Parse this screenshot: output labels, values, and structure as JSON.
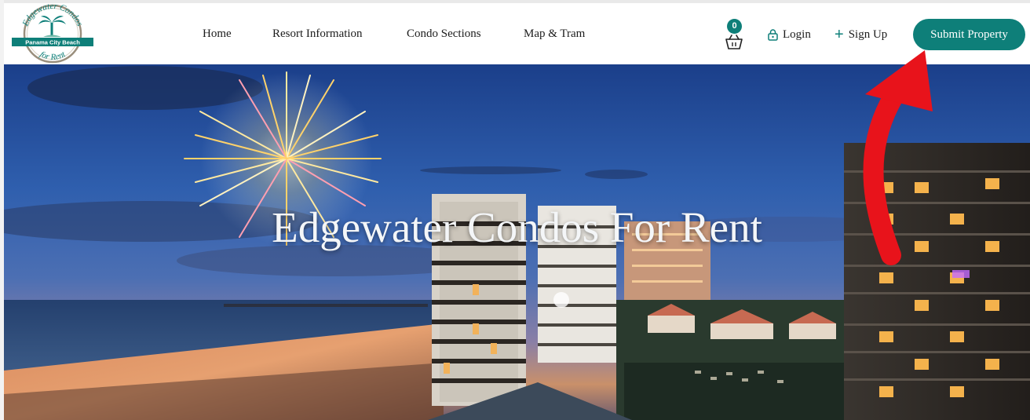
{
  "header": {
    "logo": {
      "top_text": "Edgewater Condos",
      "banner_text": "Panama City Beach",
      "bottom_text": "for Rent"
    },
    "nav": [
      {
        "label": "Home"
      },
      {
        "label": "Resort Information"
      },
      {
        "label": "Condo Sections"
      },
      {
        "label": "Map & Tram"
      }
    ],
    "cart": {
      "count": "0",
      "icon": "basket-icon"
    },
    "login": {
      "label": "Login",
      "icon": "lock-icon"
    },
    "signup": {
      "label": "Sign Up",
      "icon": "plus-icon"
    },
    "submit_button": "Submit Property"
  },
  "hero": {
    "title": "Edgewater Condos For Rent",
    "image": "fireworks-over-beach-condos-at-dusk"
  },
  "annotation": {
    "icon": "red-curved-arrow-icon"
  },
  "colors": {
    "accent": "#0e7f79",
    "arrow": "#e8131b",
    "title": "#f4f6f8"
  }
}
